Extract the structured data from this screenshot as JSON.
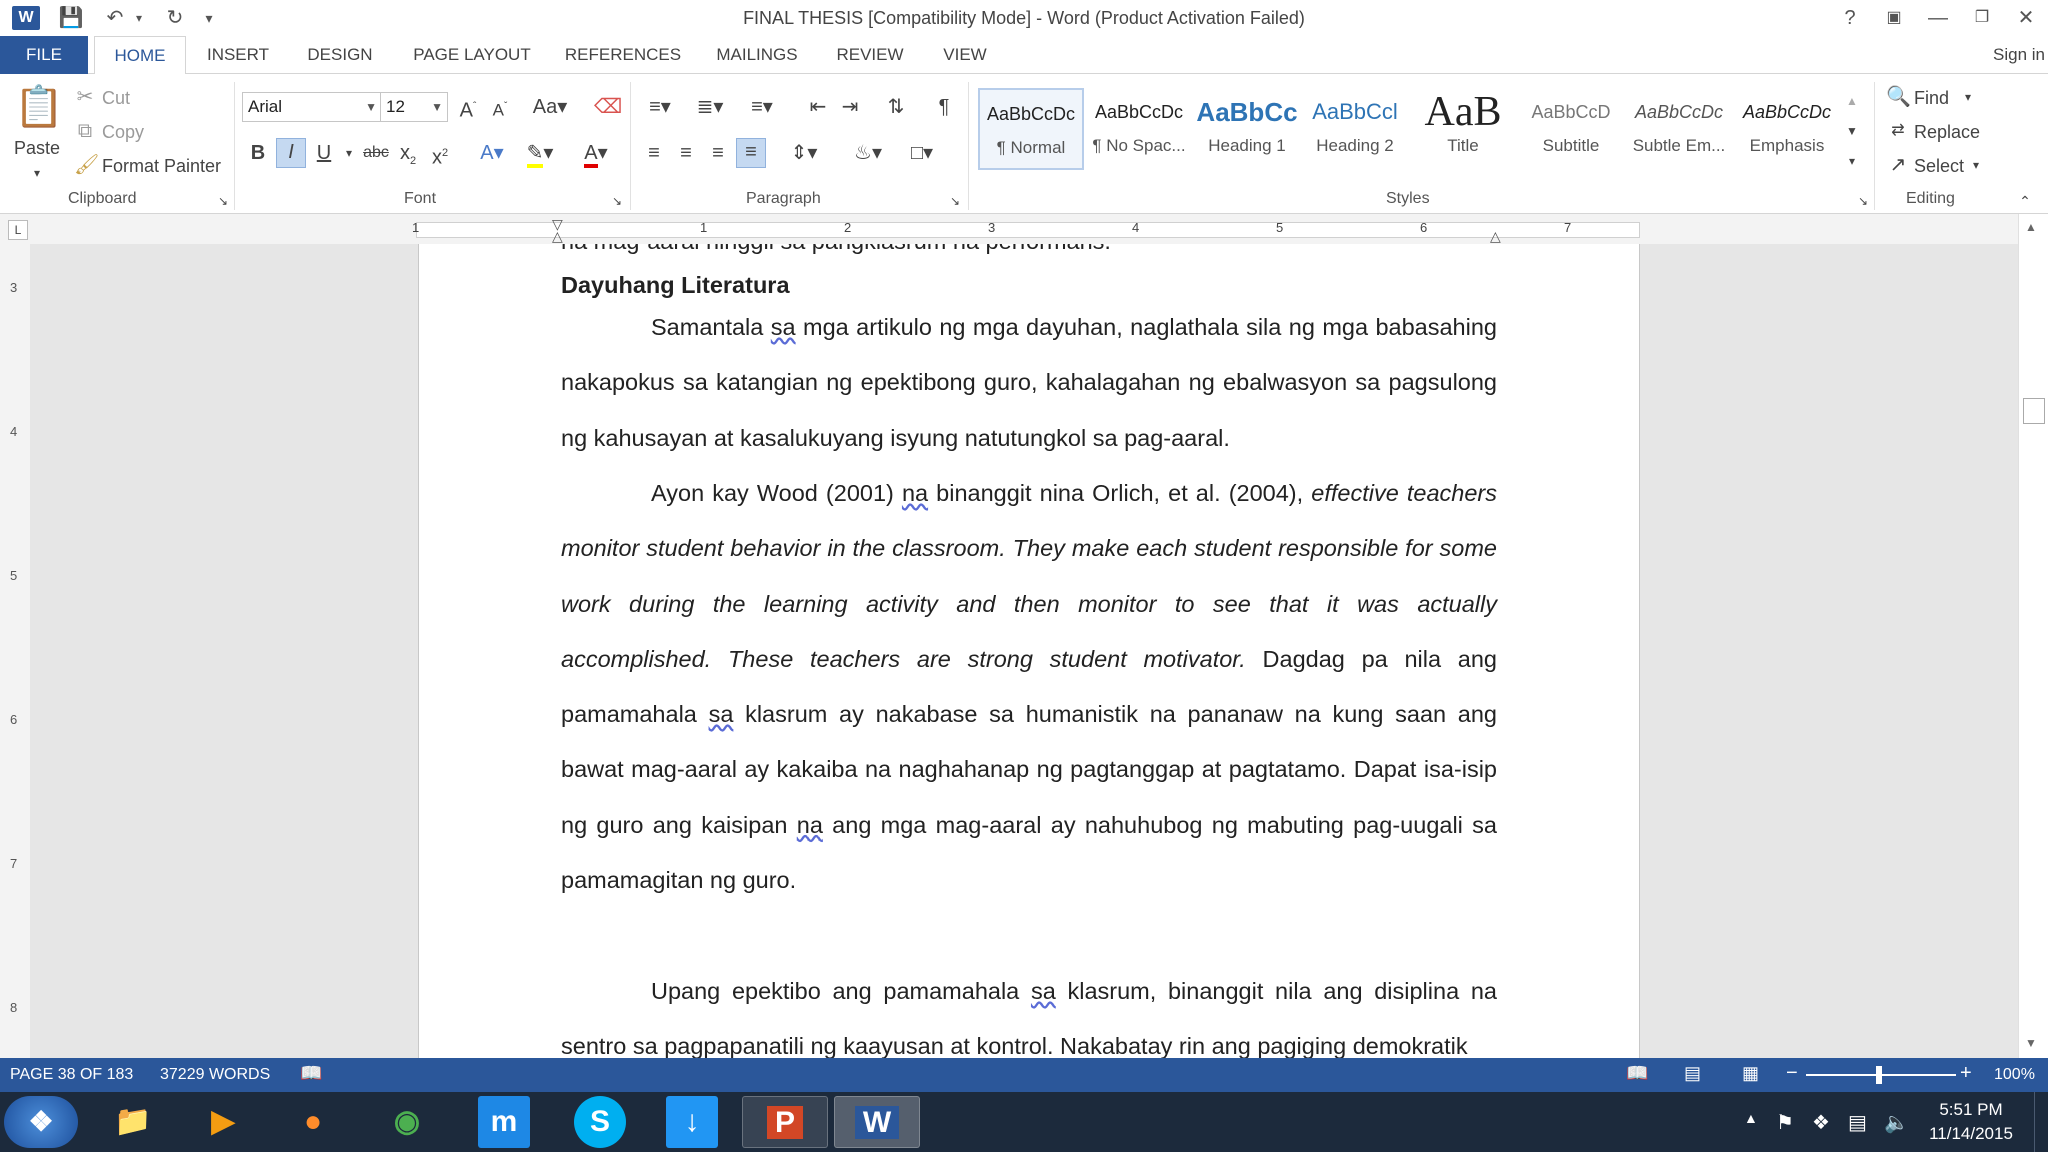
{
  "window": {
    "title": "FINAL THESIS [Compatibility Mode] - Word (Product Activation Failed)",
    "help": "?",
    "sign_in": "Sign in"
  },
  "tabs": [
    "FILE",
    "HOME",
    "INSERT",
    "DESIGN",
    "PAGE LAYOUT",
    "REFERENCES",
    "MAILINGS",
    "REVIEW",
    "VIEW"
  ],
  "ribbon": {
    "clipboard": {
      "paste": "Paste",
      "cut": "Cut",
      "copy": "Copy",
      "format_painter": "Format Painter",
      "label": "Clipboard"
    },
    "font": {
      "family": "Arial",
      "size": "12",
      "label": "Font"
    },
    "paragraph": {
      "label": "Paragraph"
    },
    "styles": {
      "label": "Styles",
      "items": [
        {
          "sample": "AaBbCcDc",
          "name": "¶ Normal"
        },
        {
          "sample": "AaBbCcDc",
          "name": "¶ No Spac..."
        },
        {
          "sample": "AaBbCc",
          "name": "Heading 1"
        },
        {
          "sample": "AaBbCcl",
          "name": "Heading 2"
        },
        {
          "sample": "AaB",
          "name": "Title"
        },
        {
          "sample": "AaBbCcD",
          "name": "Subtitle"
        },
        {
          "sample": "AaBbCcDc",
          "name": "Subtle Em..."
        },
        {
          "sample": "AaBbCcDc",
          "name": "Emphasis"
        }
      ]
    },
    "editing": {
      "find": "Find",
      "replace": "Replace",
      "select": "Select",
      "label": "Editing"
    }
  },
  "ruler": {
    "numbers": [
      "1",
      "1",
      "2",
      "3",
      "4",
      "5",
      "6",
      "7"
    ],
    "vnumbers": [
      "3",
      "4",
      "5",
      "6",
      "7",
      "8"
    ]
  },
  "document": {
    "cut_line": "na mag-aaral hinggil sa pangklasrum na performans.",
    "heading": "Dayuhang Literatura",
    "p1": {
      "a": "Samantala ",
      "sa": "sa",
      "b": " mga artikulo ng mga dayuhan, naglathala sila ng mga babasahing nakapokus sa katangian ng epektibong guro, kahalagahan ng ebalwasyon sa pagsulong ng kahusayan at kasalukuyang isyung natutungkol sa pag-aaral."
    },
    "p2": {
      "a": "Ayon kay Wood (2001) ",
      "na": "na",
      "b": " binanggit nina Orlich, et al. (2004), ",
      "italic": "effective teachers monitor student behavior in the classroom. They make each student responsible for some work during the learning activity and then monitor to see that it was actually accomplished. These teachers are strong student motivator.",
      "c": " Dagdag pa nila ang pamamahala ",
      "sa": "sa",
      "d": " klasrum ay nakabase sa humanistik na pananaw na kung saan ang bawat mag-aaral ay kakaiba na naghahanap ng pagtanggap at pagtatamo. Dapat isa-isip ng guro ang kaisipan ",
      "na2": "na",
      "e": " ang mga mag-aaral ay nahuhubog ng mabuting pag-uugali sa pamamagitan ng guro."
    },
    "p3": {
      "a": "Upang epektibo ang pamamahala ",
      "sa": "sa",
      "b": " klasrum, binanggit nila ang disiplina na sentro sa pagpapanatili ng kaayusan at kontrol. Nakabatay rin ang pagiging demokratik"
    }
  },
  "status": {
    "page": "PAGE 38 OF 183",
    "words": "37229 WORDS",
    "zoom": "100%",
    "minus": "−",
    "plus": "+"
  },
  "taskbar": {
    "apps": [
      "start",
      "explorer",
      "media-player",
      "firefox",
      "chrome",
      "maxthon",
      "skype",
      "downloader",
      "powerpoint",
      "word"
    ],
    "time": "5:51 PM",
    "date": "11/14/2015"
  },
  "colors": {
    "accent": "#2b579a",
    "taskbar": "#1c2a3c"
  }
}
